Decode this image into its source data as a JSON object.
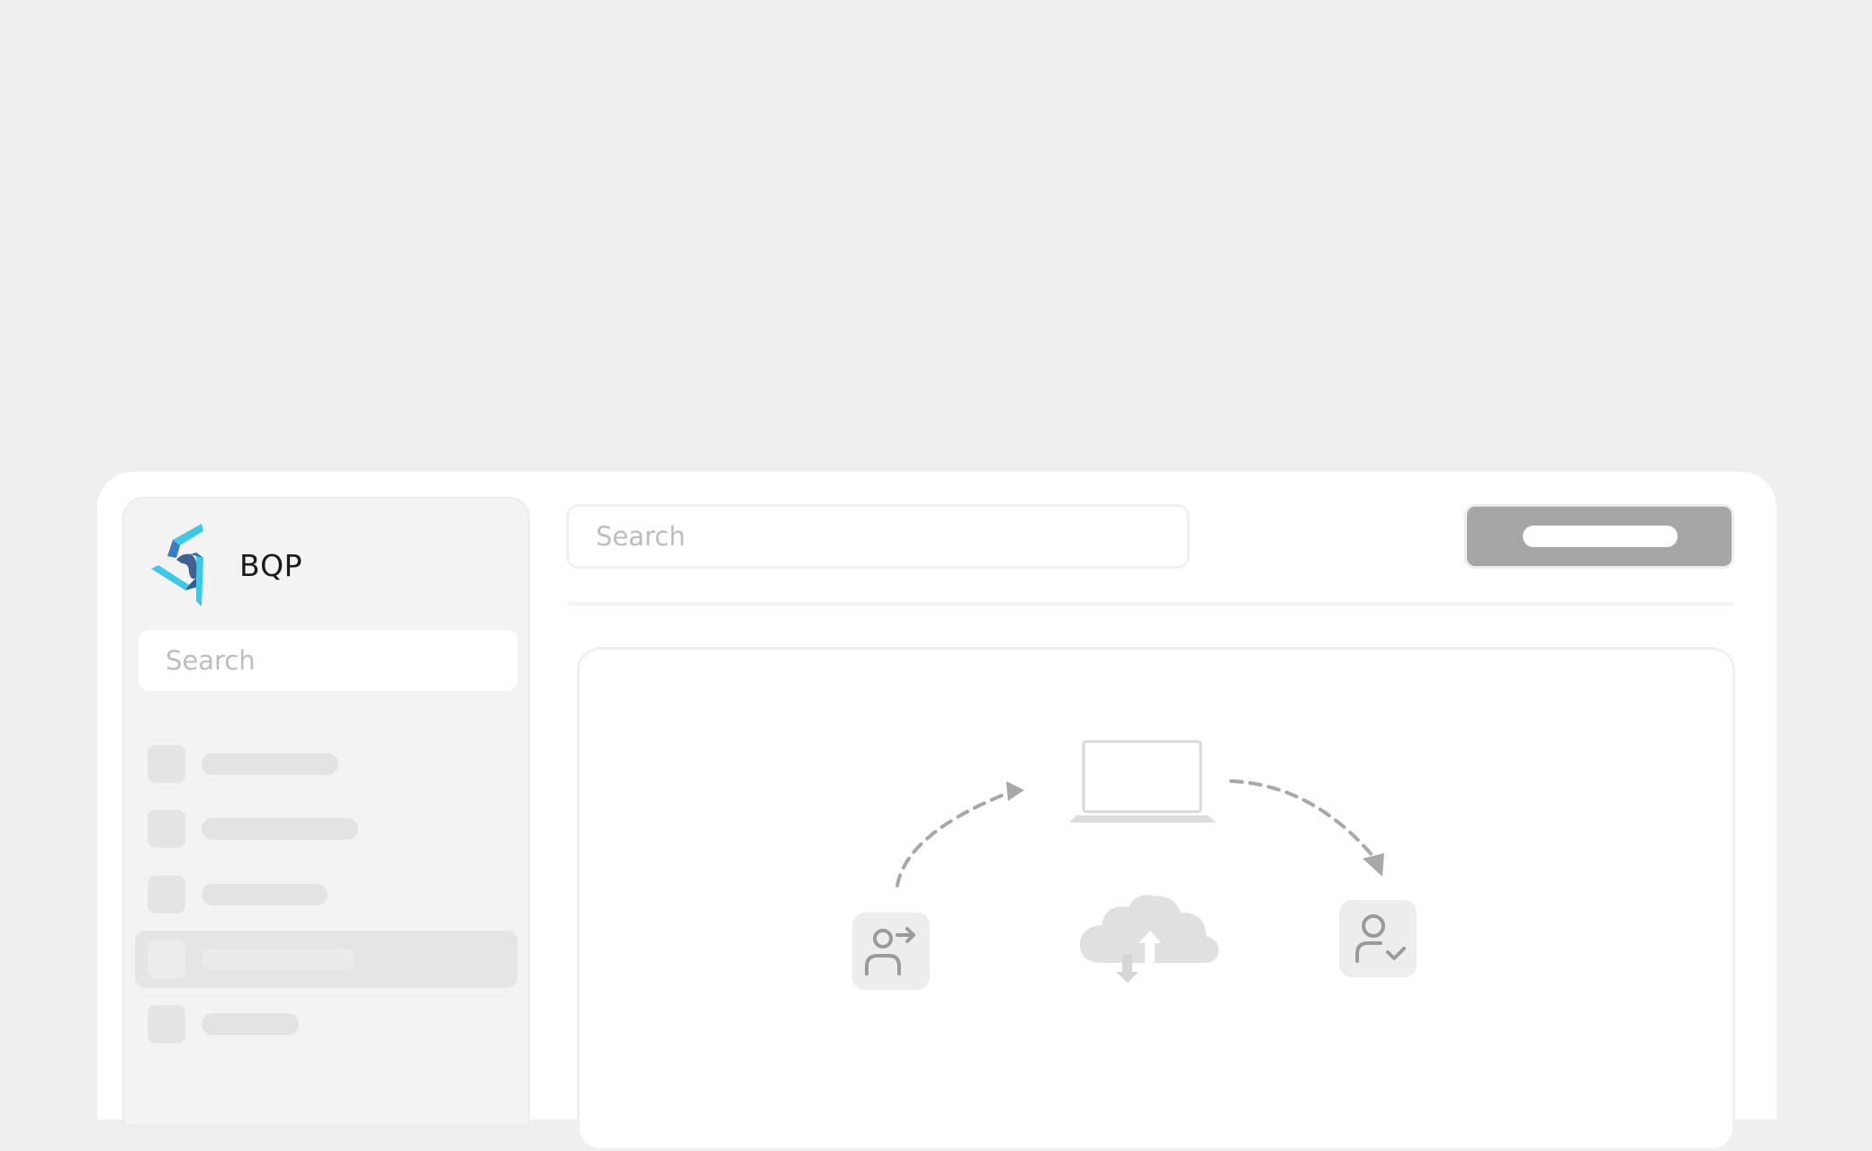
{
  "brand": {
    "name": "BQP",
    "logo_colors": [
      "#3fc7e6",
      "#2f6fb5",
      "#3a5a9a"
    ]
  },
  "sidebar": {
    "search_placeholder": "Search",
    "items": [
      {
        "icon": "placeholder-icon",
        "active": false
      },
      {
        "icon": "placeholder-icon",
        "active": false
      },
      {
        "icon": "placeholder-icon",
        "active": false
      },
      {
        "icon": "placeholder-icon",
        "active": true
      },
      {
        "icon": "placeholder-icon",
        "active": false
      }
    ]
  },
  "header": {
    "search_placeholder": "Search",
    "action_button_color": "#a6a6a6"
  },
  "illustration": {
    "icons": [
      "user-transfer-icon",
      "laptop-icon",
      "cloud-sync-icon",
      "user-check-icon"
    ]
  }
}
